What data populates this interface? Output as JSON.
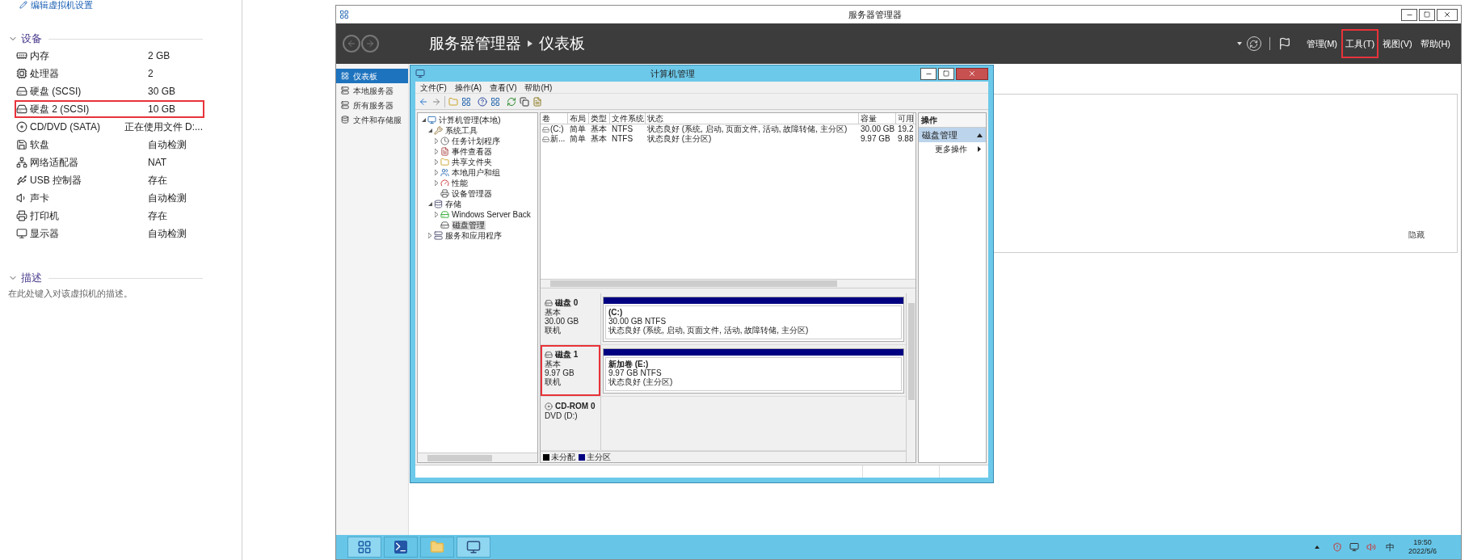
{
  "vm_settings": {
    "edit_link": "编辑虚拟机设置",
    "devices": {
      "title": "设备",
      "expanded": true,
      "items": [
        {
          "kind": "memory",
          "name": "内存",
          "value": "2 GB",
          "highlighted": false
        },
        {
          "kind": "cpu",
          "name": "处理器",
          "value": "2",
          "highlighted": false
        },
        {
          "kind": "disk",
          "name": "硬盘 (SCSI)",
          "value": "30 GB",
          "highlighted": false
        },
        {
          "kind": "disk",
          "name": "硬盘 2 (SCSI)",
          "value": "10 GB",
          "highlighted": true
        },
        {
          "kind": "cdrom",
          "name": "CD/DVD (SATA)",
          "value": "正在使用文件 D:...",
          "highlighted": false
        },
        {
          "kind": "floppy",
          "name": "软盘",
          "value": "自动检测",
          "highlighted": false
        },
        {
          "kind": "network",
          "name": "网络适配器",
          "value": "NAT",
          "highlighted": false
        },
        {
          "kind": "usb",
          "name": "USB 控制器",
          "value": "存在",
          "highlighted": false
        },
        {
          "kind": "sound",
          "name": "声卡",
          "value": "自动检测",
          "highlighted": false
        },
        {
          "kind": "printer",
          "name": "打印机",
          "value": "存在",
          "highlighted": false
        },
        {
          "kind": "display",
          "name": "显示器",
          "value": "自动检测",
          "highlighted": false
        }
      ]
    },
    "description": {
      "title": "描述",
      "expanded": true,
      "placeholder": "在此处键入对该虚拟机的描述。"
    }
  },
  "server_manager": {
    "title": "服务器管理器",
    "breadcrumb": [
      "服务器管理器",
      "仪表板"
    ],
    "menus": [
      {
        "label": "管理(M)",
        "highlighted": false
      },
      {
        "label": "工具(T)",
        "highlighted": true
      },
      {
        "label": "视图(V)",
        "highlighted": false
      },
      {
        "label": "帮助(H)",
        "highlighted": false
      }
    ],
    "nav": [
      {
        "label": "仪表板",
        "selected": true
      },
      {
        "label": "本地服务器",
        "selected": false
      },
      {
        "label": "所有服务器",
        "selected": false
      },
      {
        "label": "文件和存储服",
        "selected": false
      }
    ],
    "panel": {
      "hide_link": "隐藏"
    }
  },
  "computer_management": {
    "title": "计算机管理",
    "menus": [
      "文件(F)",
      "操作(A)",
      "查看(V)",
      "帮助(H)"
    ],
    "tree": [
      {
        "kind": "computer",
        "label": "计算机管理(本地)",
        "selected": false,
        "expanded": true,
        "children": [
          {
            "kind": "tools",
            "label": "系统工具",
            "selected": false,
            "expanded": true,
            "children": [
              {
                "kind": "scheduler",
                "label": "任务计划程序",
                "selected": false,
                "expanded": false
              },
              {
                "kind": "events",
                "label": "事件查看器",
                "selected": false,
                "expanded": false
              },
              {
                "kind": "shared",
                "label": "共享文件夹",
                "selected": false,
                "expanded": false
              },
              {
                "kind": "users",
                "label": "本地用户和组",
                "selected": false,
                "expanded": false
              },
              {
                "kind": "performance",
                "label": "性能",
                "selected": false,
                "expanded": false
              },
              {
                "kind": "devices",
                "label": "设备管理器",
                "selected": false
              }
            ]
          },
          {
            "kind": "storage",
            "label": "存储",
            "selected": false,
            "expanded": true,
            "children": [
              {
                "kind": "backup",
                "label": "Windows Server Back",
                "selected": false,
                "expanded": false
              },
              {
                "kind": "disk",
                "label": "磁盘管理",
                "selected": true
              }
            ]
          },
          {
            "kind": "services",
            "label": "服务和应用程序",
            "selected": false,
            "expanded": false
          }
        ]
      }
    ],
    "volumes": {
      "columns": [
        "卷",
        "布局",
        "类型",
        "文件系统",
        "状态",
        "容量",
        "可用"
      ],
      "rows": [
        [
          "(C:)",
          "简单",
          "基本",
          "NTFS",
          "状态良好 (系统, 启动, 页面文件, 活动, 故障转储, 主分区)",
          "30.00 GB",
          "19.2"
        ],
        [
          "新...",
          "简单",
          "基本",
          "NTFS",
          "状态良好 (主分区)",
          "9.97 GB",
          "9.88"
        ]
      ]
    },
    "disks": [
      {
        "kind": "disk",
        "name": "磁盘 0",
        "lines": [
          "基本",
          "30.00 GB",
          "联机"
        ],
        "highlighted": false,
        "partitions": [
          {
            "name": "(C:)",
            "size": "30.00 GB NTFS",
            "status": "状态良好 (系统, 启动, 页面文件, 活动, 故障转储, 主分区)"
          }
        ]
      },
      {
        "kind": "disk",
        "name": "磁盘 1",
        "lines": [
          "基本",
          "9.97 GB",
          "联机"
        ],
        "highlighted": true,
        "partitions": [
          {
            "name": "新加卷  (E:)",
            "size": "9.97 GB NTFS",
            "status": "状态良好 (主分区)"
          }
        ]
      },
      {
        "kind": "cdrom",
        "name": "CD-ROM 0",
        "lines": [
          "DVD (D:)"
        ],
        "highlighted": false
      }
    ],
    "legend": [
      {
        "label": "未分配",
        "color": "#000000"
      },
      {
        "label": "主分区",
        "color": "#000080"
      }
    ],
    "actions": {
      "title": "操作",
      "section": "磁盘管理",
      "expanded": true,
      "item": "更多操作"
    }
  },
  "taskbar": {
    "ime": "中",
    "time": "19:50",
    "date": "2022/5/6"
  }
}
